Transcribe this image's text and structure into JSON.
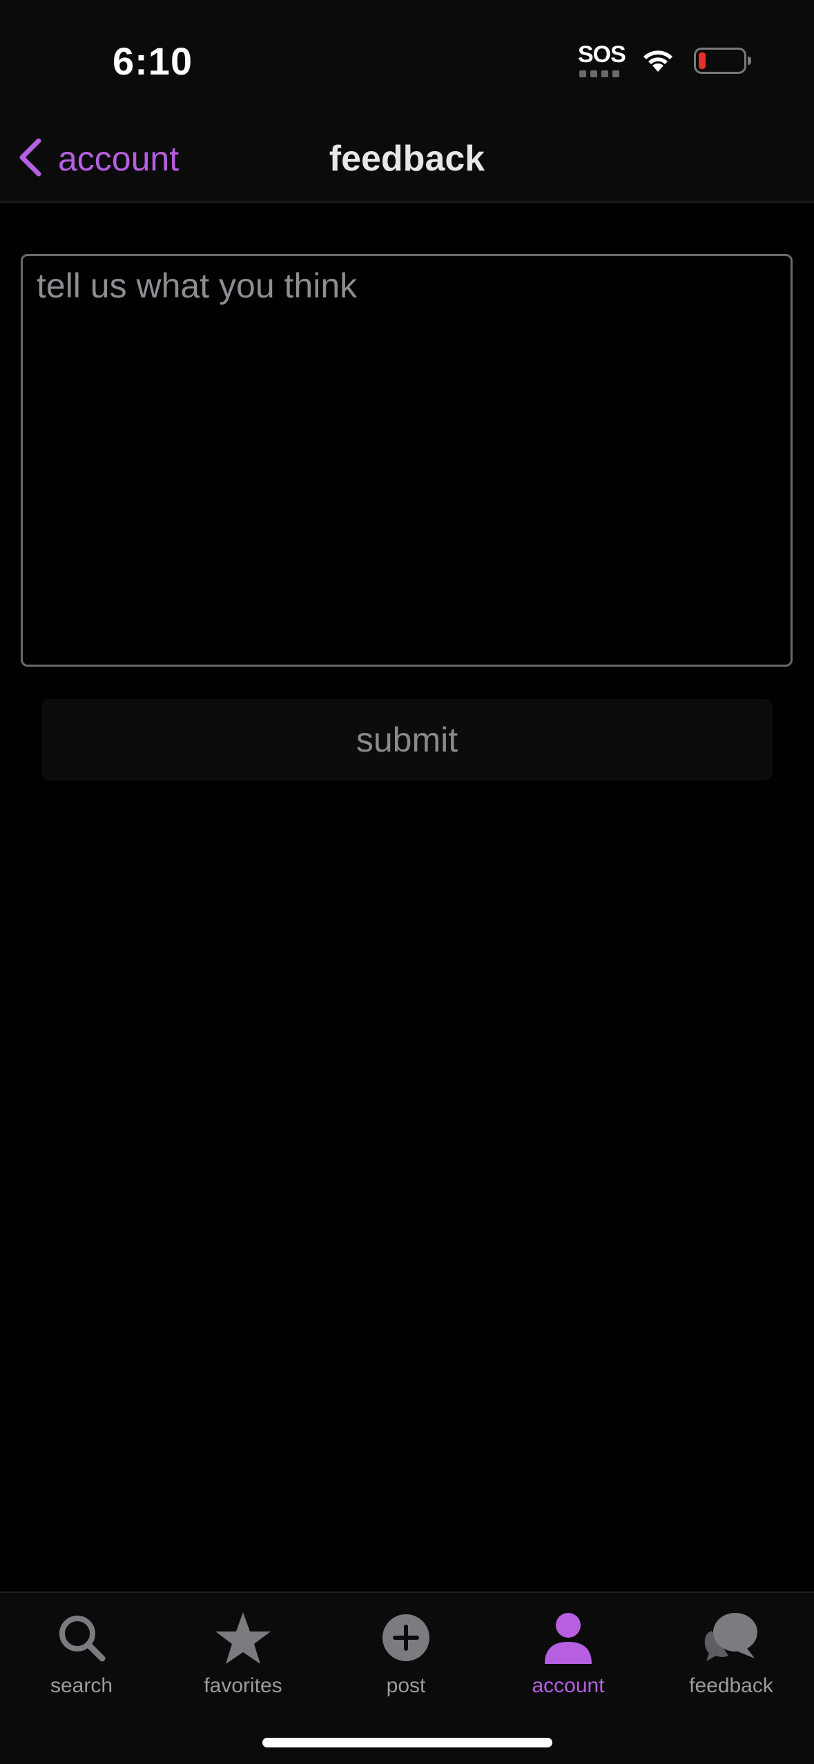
{
  "status_bar": {
    "time": "6:10",
    "sos": "SOS",
    "icons": [
      "wifi-icon",
      "battery-icon"
    ]
  },
  "nav": {
    "back_label": "account",
    "title": "feedback"
  },
  "form": {
    "feedback_placeholder": "tell us what you think",
    "feedback_value": "",
    "submit_label": "submit"
  },
  "tabs": [
    {
      "label": "search",
      "icon": "search-icon",
      "active": false
    },
    {
      "label": "favorites",
      "icon": "star-icon",
      "active": false
    },
    {
      "label": "post",
      "icon": "plus-circle-icon",
      "active": false
    },
    {
      "label": "account",
      "icon": "person-icon",
      "active": true
    },
    {
      "label": "feedback",
      "icon": "chat-bubbles-icon",
      "active": false
    }
  ],
  "colors": {
    "accent": "#b65fe1",
    "background": "#000000",
    "bar_background": "#0b0b0c",
    "inactive": "#9b9ba0",
    "battery_low": "#e5302a"
  }
}
